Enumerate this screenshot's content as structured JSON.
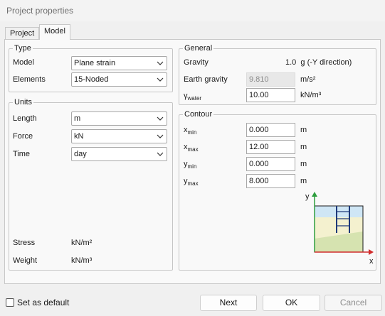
{
  "window": {
    "title": "Project properties"
  },
  "tabs": [
    {
      "label": "Project"
    },
    {
      "label": "Model"
    }
  ],
  "type_group": {
    "legend": "Type",
    "model_label": "Model",
    "model_value": "Plane strain",
    "elements_label": "Elements",
    "elements_value": "15-Noded"
  },
  "units_group": {
    "legend": "Units",
    "length_label": "Length",
    "length_value": "m",
    "force_label": "Force",
    "force_value": "kN",
    "time_label": "Time",
    "time_value": "day",
    "stress_label": "Stress",
    "stress_value": "kN/m²",
    "weight_label": "Weight",
    "weight_value": "kN/m³"
  },
  "general_group": {
    "legend": "General",
    "gravity_label": "Gravity",
    "gravity_value": "1.0  g (-Y direction)",
    "earth_gravity_label": "Earth gravity",
    "earth_gravity_value": "9.810",
    "earth_gravity_unit": "m/s²",
    "gamma_symbol": "γ",
    "gamma_sub": "water",
    "gamma_water_value": "10.00",
    "gamma_water_unit": "kN/m³"
  },
  "contour_group": {
    "legend": "Contour",
    "rows": [
      {
        "var": "x",
        "sub": "min",
        "value": "0.000",
        "unit": "m"
      },
      {
        "var": "x",
        "sub": "max",
        "value": "12.00",
        "unit": "m"
      },
      {
        "var": "y",
        "sub": "min",
        "value": "0.000",
        "unit": "m"
      },
      {
        "var": "y",
        "sub": "max",
        "value": "8.000",
        "unit": "m"
      }
    ],
    "axis_x": "x",
    "axis_y": "y"
  },
  "footer": {
    "set_default_label": "Set as default",
    "next_label": "Next",
    "ok_label": "OK",
    "cancel_label": "Cancel"
  },
  "colors": {
    "axis_green": "#2e9e3e",
    "axis_red": "#d12d2d",
    "sky_blue": "#cfe6f5",
    "soil_light": "#f4f1cf",
    "soil_green": "#d6e3b0",
    "structure": "#1f3a7a"
  }
}
